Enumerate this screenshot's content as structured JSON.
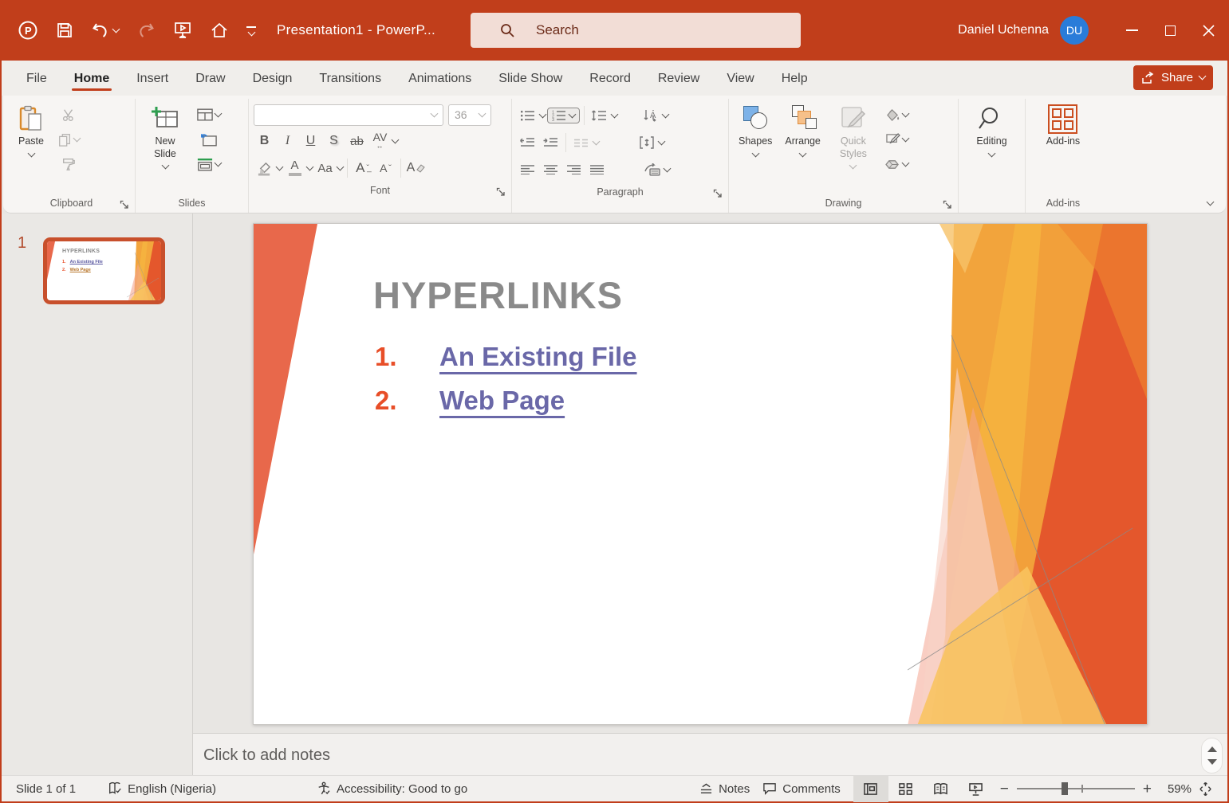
{
  "titlebar": {
    "title": "Presentation1 - PowerP...",
    "search_placeholder": "Search",
    "user_name": "Daniel Uchenna",
    "user_initials": "DU"
  },
  "menu": {
    "tabs": [
      "File",
      "Home",
      "Insert",
      "Draw",
      "Design",
      "Transitions",
      "Animations",
      "Slide Show",
      "Record",
      "Review",
      "View",
      "Help"
    ],
    "active_tab": "Home",
    "share_label": "Share"
  },
  "ribbon": {
    "clipboard": {
      "paste_label": "Paste",
      "group_label": "Clipboard"
    },
    "slides": {
      "new_slide_label": "New Slide",
      "group_label": "Slides"
    },
    "font": {
      "font_size": "36",
      "group_label": "Font",
      "glyphs": {
        "bold": "B",
        "italic": "I",
        "underline": "U",
        "shadow": "S",
        "strikethrough": "ab",
        "spacing": "AV",
        "case": "Aa",
        "grow": "A",
        "shrink": "A",
        "clear": "A"
      }
    },
    "paragraph": {
      "group_label": "Paragraph"
    },
    "drawing": {
      "shapes_label": "Shapes",
      "arrange_label": "Arrange",
      "quick_styles_label": "Quick Styles",
      "group_label": "Drawing"
    },
    "editing": {
      "editing_label": "Editing"
    },
    "addins": {
      "button_label": "Add-ins",
      "group_label": "Add-ins"
    }
  },
  "thumbnail_panel": {
    "slide_number": "1"
  },
  "slide": {
    "title": "HYPERLINKS",
    "list": [
      {
        "num": "1.",
        "text": "An Existing File"
      },
      {
        "num": "2.",
        "text": "Web Page"
      }
    ]
  },
  "notes": {
    "placeholder": "Click to add notes"
  },
  "statusbar": {
    "slide_indicator": "Slide 1 of 1",
    "language": "English (Nigeria)",
    "accessibility_status": "Accessibility: Good to go",
    "notes_label": "Notes",
    "comments_label": "Comments",
    "zoom_percent": "59%"
  },
  "colors": {
    "accent_red": "#c13e1b",
    "avatar_blue": "#2a7cd9",
    "slide_wedge_orange": "#e8684b",
    "hyperlink_purple": "#6a68a8",
    "followed_link_orange": "#b8762b",
    "list_number_orange": "#e84e28",
    "slide_title_gray": "#8a8a8a"
  },
  "icons": {
    "app": "powerpoint-logo",
    "save": "floppy-disk",
    "undo": "arrow-undo",
    "redo": "arrow-redo",
    "present": "screen-play",
    "home": "house",
    "search": "magnifier",
    "minimize": "dash",
    "maximize": "square",
    "close": "x",
    "share": "share-arrow",
    "spellcheck": "book-check",
    "accessibility": "person-check",
    "zoom_fit": "fit-slide-diamond"
  }
}
